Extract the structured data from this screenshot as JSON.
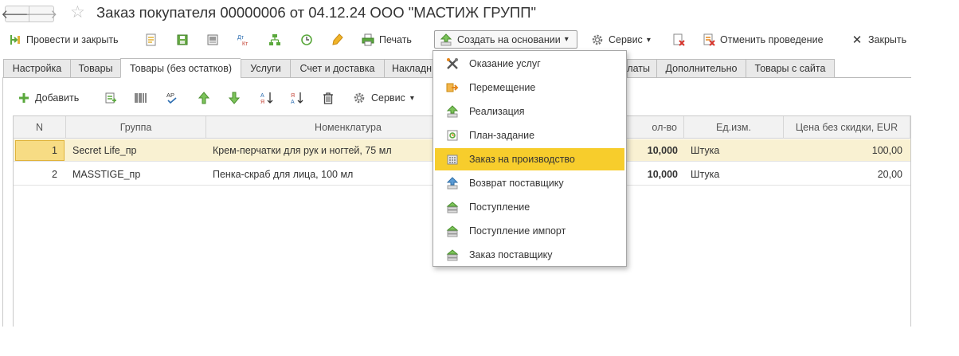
{
  "window": {
    "title": "Заказ покупателя 00000006 от 04.12.24 ООО \"МАСТИЖ ГРУПП\"",
    "back_glyph": "🡐",
    "forward_glyph": "🡒",
    "favorite_glyph": "☆"
  },
  "toolbar": {
    "post_and_close": "Провести и закрыть",
    "print": "Печать",
    "create_based_on": "Создать на основании",
    "service": "Сервис",
    "cancel_posting": "Отменить проведение",
    "close": "Закрыть",
    "dropdown_arrow": "▾"
  },
  "tabs": [
    {
      "label": "Настройка"
    },
    {
      "label": "Товары"
    },
    {
      "label": "Товары (без остатков)"
    },
    {
      "label": "Услуги"
    },
    {
      "label": "Счет и доставка"
    },
    {
      "label": "Накладн"
    },
    {
      "label": "латы"
    },
    {
      "label": "Дополнительно"
    },
    {
      "label": "Товары с сайта"
    }
  ],
  "table_toolbar": {
    "add": "Добавить",
    "service": "Сервис"
  },
  "table": {
    "columns": [
      "N",
      "Группа",
      "Номенклатура",
      "ол-во",
      "Ед.изм.",
      "Цена без скидки, EUR"
    ],
    "rows": [
      {
        "n": "1",
        "group": "Secret Life_пр",
        "item": "Крем-перчатки для рук и ногтей, 75 мл",
        "qty": "10,000",
        "unit": "Штука",
        "price": "100,00"
      },
      {
        "n": "2",
        "group": "MASSTIGE_пр",
        "item": "Пенка-скраб для лица, 100 мл",
        "qty": "10,000",
        "unit": "Штука",
        "price": "20,00"
      }
    ]
  },
  "menu": {
    "items": [
      {
        "label": "Оказание услуг",
        "icon": "tools-icon"
      },
      {
        "label": "Перемещение",
        "icon": "move-arrow-icon"
      },
      {
        "label": "Реализация",
        "icon": "sale-up-icon"
      },
      {
        "label": "План-задание",
        "icon": "plan-doc-icon"
      },
      {
        "label": "Заказ на производство",
        "icon": "factory-icon"
      },
      {
        "label": "Возврат поставщику",
        "icon": "return-up-icon"
      },
      {
        "label": "Поступление",
        "icon": "receipt-icon"
      },
      {
        "label": "Поступление импорт",
        "icon": "receipt-import-icon"
      },
      {
        "label": "Заказ поставщику",
        "icon": "supplier-order-icon"
      }
    ],
    "highlighted_index": 4
  },
  "colors": {
    "highlight": "#f7cd2c",
    "selected_row": "#f9f1d2",
    "green_icon": "#5aa83c",
    "accent_orange": "#e5861a"
  }
}
